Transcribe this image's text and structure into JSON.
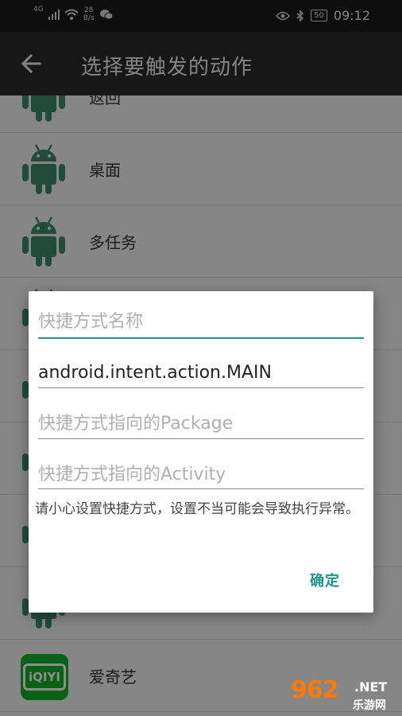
{
  "status_bar": {
    "network_type": "4G",
    "speed_value": "28",
    "speed_unit": "B/s",
    "battery": "50",
    "time": "09:12"
  },
  "app_bar": {
    "title": "选择要触发的动作"
  },
  "list": {
    "items": [
      {
        "label": "返回",
        "icon": "android-robot-icon"
      },
      {
        "label": "桌面",
        "icon": "android-robot-icon"
      },
      {
        "label": "多任务",
        "icon": "android-robot-icon"
      },
      {
        "label": "",
        "icon": "android-robot-icon"
      },
      {
        "label": "",
        "icon": "android-robot-icon"
      },
      {
        "label": "",
        "icon": "android-robot-icon"
      },
      {
        "label": "",
        "icon": "android-robot-icon"
      },
      {
        "label": "",
        "icon": "android-robot-icon"
      },
      {
        "label": "爱奇艺",
        "icon": "iqiyi-app-icon"
      }
    ]
  },
  "dialog": {
    "name_placeholder": "快捷方式名称",
    "intent_value": "android.intent.action.MAIN",
    "package_placeholder": "快捷方式指向的Package",
    "activity_placeholder": "快捷方式指向的Activity",
    "warning": "请小心设置快捷方式，设置不当可能会导致执行异常。",
    "confirm_label": "确定"
  },
  "watermark": {
    "number": "962",
    "net": ".NET",
    "site": "乐游网"
  },
  "colors": {
    "accent": "#1f9687",
    "robot_green": "#3d8a6d",
    "iqiyi_green": "#12b02b"
  }
}
